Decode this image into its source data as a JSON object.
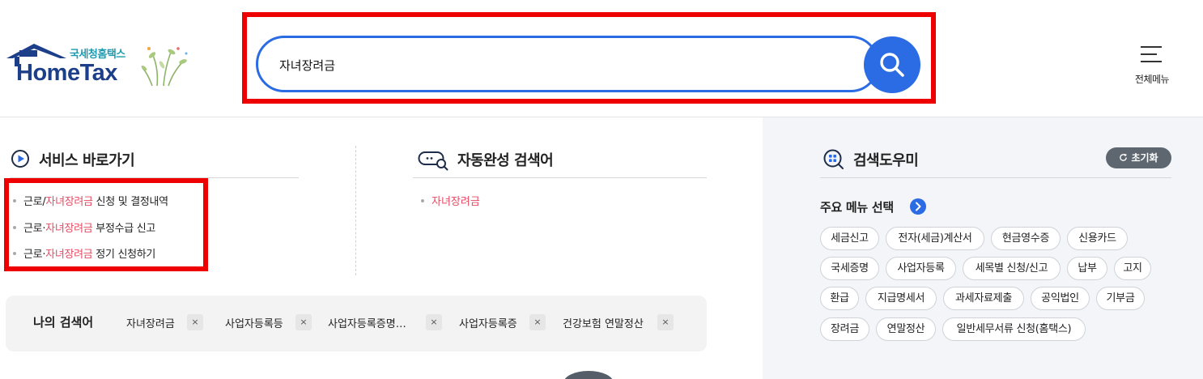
{
  "header": {
    "logo_sub": "국세청홈택스",
    "logo_main": "HomeTax",
    "search_value": "자녀장려금",
    "menu_label": "전체메뉴"
  },
  "service": {
    "title": "서비스 바로가기",
    "items": [
      {
        "prefix": "근로/",
        "highlight": "자녀장려금",
        "suffix": " 신청 및 결정내역"
      },
      {
        "prefix": "근로·",
        "highlight": "자녀장려금",
        "suffix": " 부정수급 신고"
      },
      {
        "prefix": "근로·",
        "highlight": "자녀장려금",
        "suffix": " 정기 신청하기"
      }
    ]
  },
  "autocomplete": {
    "title": "자동완성 검색어",
    "items": [
      "자녀장려금"
    ]
  },
  "recent": {
    "title": "나의 검색어",
    "delete_symbol": "×",
    "keywords": [
      "자녀장려금",
      "사업자등록등",
      "사업자등록증명…",
      "사업자등록증",
      "건강보험 연말정산"
    ]
  },
  "helper": {
    "title": "검색도우미",
    "reset_label": "초기화",
    "menu_select_title": "주요 메뉴 선택",
    "chips": [
      "세금신고",
      "전자(세금)계산서",
      "현금영수증",
      "신용카드",
      "국세증명",
      "사업자등록",
      "세목별 신청/신고",
      "납부",
      "고지",
      "환급",
      "지급명세서",
      "과세자료제출",
      "공익법인",
      "기부금",
      "장려금",
      "연말정산",
      "일반세무서류 신청(홈택스)"
    ]
  },
  "colors": {
    "accent": "#2b6be4",
    "highlight_text": "#e44a62",
    "annotation_red": "#ee0000",
    "logo_blue": "#1d3f8a",
    "logo_teal": "#1d9bb0"
  },
  "icons": [
    "search-icon",
    "hamburger-menu-icon",
    "play-circle-icon",
    "chat-search-icon",
    "grid-search-icon",
    "refresh-icon",
    "chevron-right-icon",
    "close-icon"
  ]
}
